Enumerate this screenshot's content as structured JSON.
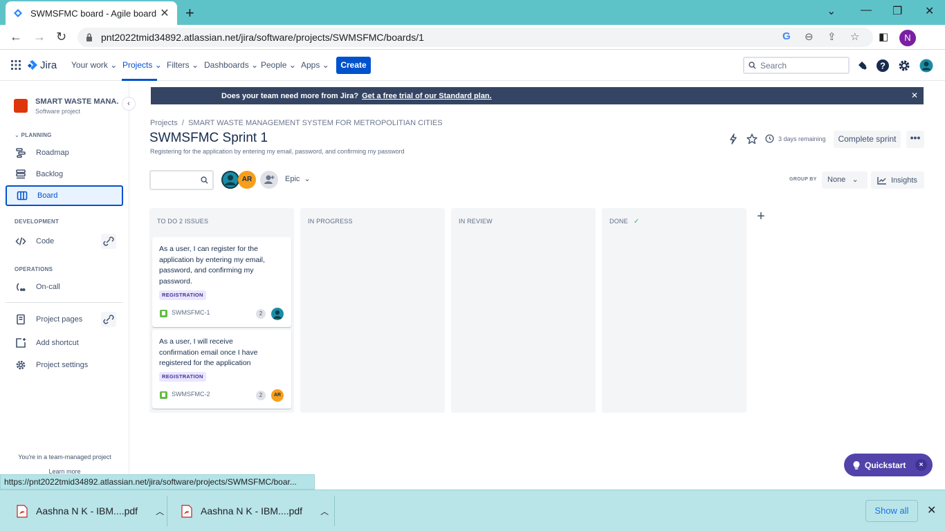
{
  "browser": {
    "tab_title": "SWMSFMC board - Agile board - ",
    "url": "pnt2022tmid34892.atlassian.net/jira/software/projects/SWMSFMC/boards/1",
    "profile_initial": "N",
    "status_url": "https://pnt2022tmid34892.atlassian.net/jira/software/projects/SWMSFMC/boar..."
  },
  "jira_nav": {
    "logo": "Jira",
    "items": [
      "Your work",
      "Projects",
      "Filters",
      "Dashboards",
      "People",
      "Apps"
    ],
    "create": "Create",
    "search_placeholder": "Search"
  },
  "sidebar": {
    "project_name": "SMART WASTE MANA...",
    "project_type": "Software project",
    "planning_label": "PLANNING",
    "roadmap": "Roadmap",
    "backlog": "Backlog",
    "board": "Board",
    "development_label": "DEVELOPMENT",
    "code": "Code",
    "operations_label": "OPERATIONS",
    "oncall": "On-call",
    "project_pages": "Project pages",
    "add_shortcut": "Add shortcut",
    "project_settings": "Project settings",
    "footer": "You're in a team-managed project",
    "learn_more": "Learn more"
  },
  "banner": {
    "text": "Does your team need more from Jira?",
    "link": "Get a free trial of our Standard plan."
  },
  "header": {
    "crumb_root": "Projects",
    "crumb_sep": "/",
    "crumb_project": "SMART WASTE MANAGEMENT SYSTEM FOR METROPOLITIAN CITIES",
    "title": "SWMSFMC Sprint 1",
    "goal": "Registering for the application by entering my email, password, and confirming my password",
    "days_remaining": "3 days remaining",
    "complete_sprint": "Complete sprint",
    "more": "•••"
  },
  "filters": {
    "avatar_ar": "AR",
    "epic": "Epic",
    "group_by_label": "GROUP BY",
    "group_by_value": "None",
    "insights": "Insights"
  },
  "columns": [
    {
      "title": "TO DO 2 ISSUES"
    },
    {
      "title": "IN PROGRESS"
    },
    {
      "title": "IN REVIEW"
    },
    {
      "title": "DONE"
    }
  ],
  "cards": [
    {
      "summary": "As a user, I can register for the application by entering my email, password, and confirming my password.",
      "epic": "REGISTRATION",
      "key": "SWMSFMC-1",
      "points": "2",
      "assignee": ""
    },
    {
      "summary": "As a user, I will receive confirmation email once I have registered for the application",
      "epic": "REGISTRATION",
      "key": "SWMSFMC-2",
      "points": "2",
      "assignee": "AR"
    }
  ],
  "quickstart": {
    "label": "Quickstart",
    "close": "×"
  },
  "downloads": {
    "items": [
      {
        "name": "Aashna N K - IBM....pdf"
      },
      {
        "name": "Aashna N K - IBM....pdf"
      }
    ],
    "show_all": "Show all"
  },
  "colors": {
    "browser_tabstrip": "#5ec3c9",
    "jira_blue": "#0052cc",
    "banner_bg": "#344563",
    "quickstart_bg": "#5243aa",
    "epic_lozenge_bg": "#eae6ff",
    "download_bar": "#b9e5e9"
  }
}
